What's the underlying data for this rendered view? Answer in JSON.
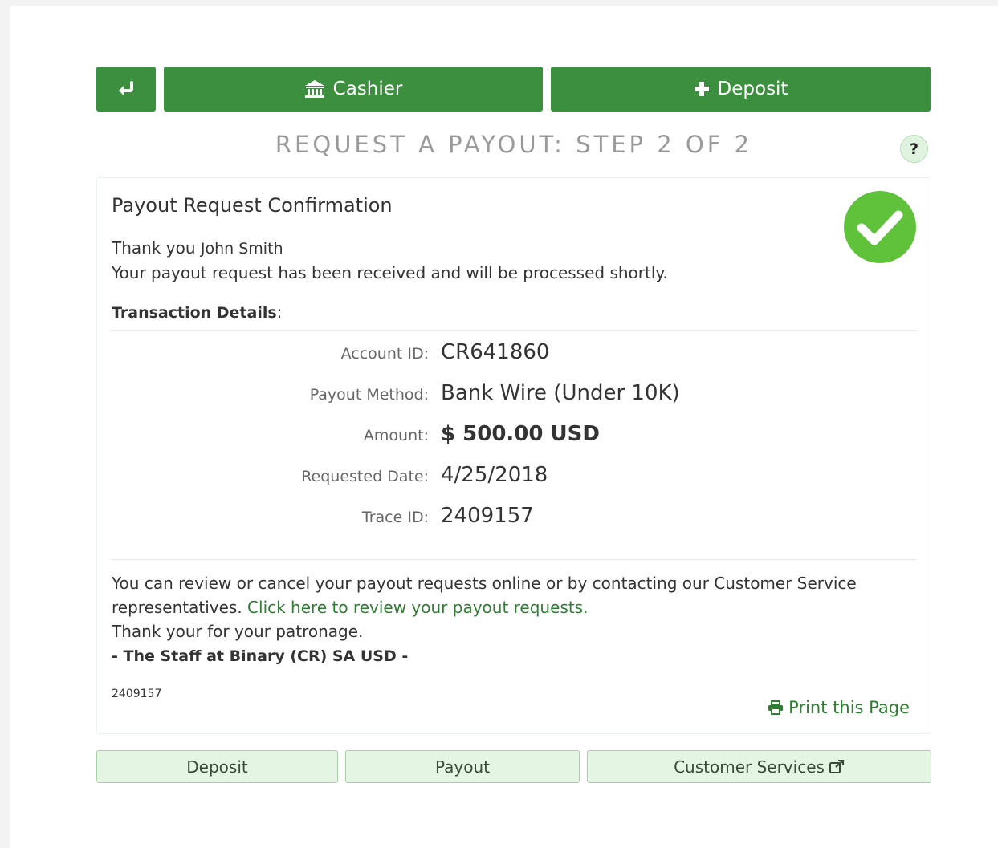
{
  "topnav": {
    "back_icon": "return-arrow-icon",
    "cashier_icon": "bank-icon",
    "cashier_label": "Cashier",
    "deposit_icon": "plus-icon",
    "deposit_label": "Deposit"
  },
  "step_title": "REQUEST A PAYOUT: STEP 2 OF 2",
  "help_label": "?",
  "card": {
    "title": "Payout Request Confirmation",
    "success_icon": "check-circle-icon",
    "thank_prefix": "Thank you",
    "user_name": "John Smith",
    "received_message": "Your payout request has been received and will be processed shortly.",
    "details_heading": "Transaction Details",
    "details_colon": ":",
    "details": [
      {
        "label": "Account ID:",
        "value": "CR641860"
      },
      {
        "label": "Payout Method:",
        "value": "Bank Wire (Under 10K)"
      },
      {
        "label": "Amount:",
        "value": "$ 500.00 USD"
      },
      {
        "label": "Requested Date:",
        "value": "4/25/2018"
      },
      {
        "label": "Trace ID:",
        "value": "2409157"
      }
    ],
    "review_text": "You can review or cancel your payout requests online or by contacting our Customer Service representatives.",
    "review_link": "Click here to review your payout requests.",
    "patronage": "Thank your for your patronage.",
    "signature": "- The Staff at Binary (CR) SA USD -",
    "trace_small": "2409157",
    "print_icon": "printer-icon",
    "print_label": "Print this Page"
  },
  "bottomnav": {
    "deposit_label": "Deposit",
    "payout_label": "Payout",
    "customer_services_label": "Customer Services",
    "external_icon": "external-link-icon"
  },
  "colors": {
    "primary": "#3c8f3e",
    "link": "#2e7d32",
    "success": "#5fc23a",
    "light_button": "#e4f5e4"
  }
}
